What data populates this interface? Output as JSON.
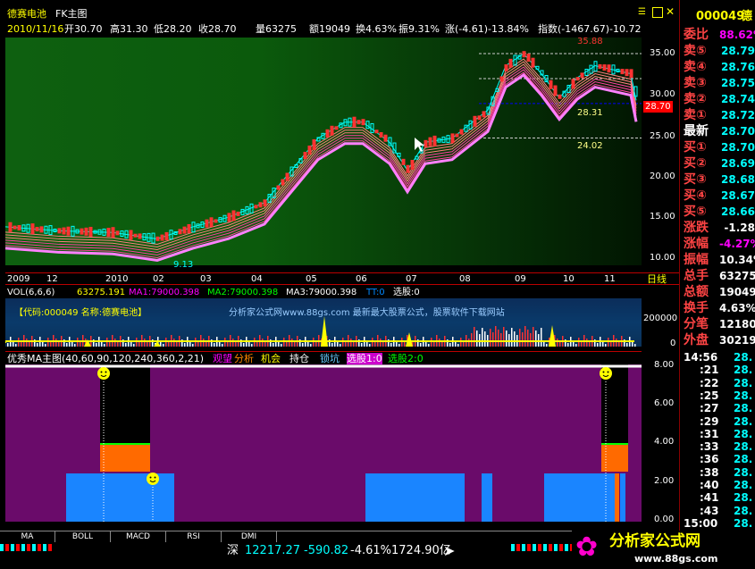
{
  "header": {
    "stock_name": "德赛电池",
    "chart_mode": "FK主图",
    "toolbar_icons": [
      "list-icon",
      "grid-icon",
      "close-icon"
    ],
    "quote_line": {
      "date": "2010/11/16",
      "open": "开30.70",
      "high": "高31.30",
      "low": "低28.20",
      "close": "收28.70",
      "volume": "量63275",
      "amount": "额19049",
      "turnover": "换4.63%",
      "amplitude": "振9.31%",
      "change": "涨(-4.61)-13.84%",
      "index": "指数(-1467.67)-10.72"
    }
  },
  "price_chart": {
    "price_labels": {
      "top": "35.88",
      "mid": "28.31",
      "low": "24.02",
      "bottom": "9.13",
      "current": "28.70"
    },
    "y_ticks": [
      "35.00",
      "30.00",
      "25.00",
      "20.00",
      "15.00",
      "10.00"
    ],
    "x_ticks": [
      "2009",
      "12",
      "2010",
      "02",
      "03",
      "04",
      "05",
      "06",
      "07",
      "08",
      "09",
      "10",
      "11"
    ],
    "period": "日线"
  },
  "volume_panel": {
    "legend": {
      "title": "VOL(6,6,6)",
      "v": "63275.191",
      "ma1": "MA1:79000.398",
      "ma2": "MA2:79000.398",
      "ma3": "MA3:79000.398",
      "tt": "TT:0",
      "xg": "选股:0"
    },
    "watermark": "【代码:000049 名称:德赛电池】",
    "site_note": "分析家公式网www.88gs.com 最新最大股票公式，股票软件下载网站",
    "y_ticks": [
      "200000",
      "0"
    ]
  },
  "indicator_panel": {
    "legend": {
      "title": "优秀MA主图(40,60,90,120,240,360,2,21)",
      "watch": "观望",
      "analysis": "分析",
      "opportunity": "机会",
      "hold": "持仓",
      "lock": "锁坑",
      "pick1": "选股1:0",
      "pick2": "选股2:0"
    },
    "y_ticks": [
      "8.00",
      "6.00",
      "4.00",
      "2.00",
      "0.00"
    ]
  },
  "right_panel": {
    "code": "000049",
    "name_part": "德",
    "weibi_label": "委比",
    "weibi_value": "88.62%",
    "sells": [
      {
        "label": "卖⑤",
        "price": "28.79"
      },
      {
        "label": "卖④",
        "price": "28.76"
      },
      {
        "label": "卖③",
        "price": "28.75"
      },
      {
        "label": "卖②",
        "price": "28.74"
      },
      {
        "label": "卖①",
        "price": "28.72"
      }
    ],
    "latest_label": "最新",
    "latest_value": "28.70",
    "buys": [
      {
        "label": "买①",
        "price": "28.70"
      },
      {
        "label": "买②",
        "price": "28.69"
      },
      {
        "label": "买③",
        "price": "28.68"
      },
      {
        "label": "买④",
        "price": "28.67"
      },
      {
        "label": "买⑤",
        "price": "28.66"
      }
    ],
    "stats": [
      {
        "label": "涨跌",
        "value": "-1.28"
      },
      {
        "label": "涨幅",
        "value": "-4.27%"
      },
      {
        "label": "振幅",
        "value": "10.34%"
      },
      {
        "label": "总手",
        "value": "63275"
      },
      {
        "label": "总额",
        "value": "19049"
      },
      {
        "label": "换手",
        "value": "4.63%"
      },
      {
        "label": "分笔",
        "value": "12180"
      },
      {
        "label": "外盘",
        "value": "30219"
      }
    ],
    "ticks": [
      {
        "time": "14:56",
        "price": "28."
      },
      {
        "time": ":21",
        "price": "28."
      },
      {
        "time": ":22",
        "price": "28."
      },
      {
        "time": ":25",
        "price": "28."
      },
      {
        "time": ":27",
        "price": "28."
      },
      {
        "time": ":29",
        "price": "28."
      },
      {
        "time": ":31",
        "price": "28."
      },
      {
        "time": ":33",
        "price": "28."
      },
      {
        "time": ":36",
        "price": "28."
      },
      {
        "time": ":38",
        "price": "28."
      },
      {
        "time": ":40",
        "price": "28."
      },
      {
        "time": ":41",
        "price": "28."
      },
      {
        "time": ":43",
        "price": "28."
      },
      {
        "time": "15:00",
        "price": "28."
      }
    ]
  },
  "tabs": [
    "MA",
    "BOLL",
    "MACD",
    "RSI",
    "DMI"
  ],
  "status_bar": {
    "market": "深",
    "index_value": "12217.27",
    "change": "-590.82",
    "pct": "-4.61%",
    "amount": "1724.90亿"
  },
  "logo": {
    "text": "分析家公式网",
    "url": "www.88gs.com"
  },
  "colors": {
    "up": "#ff3232",
    "down": "#00ffff",
    "ma_pink": "#ff80ff",
    "purple_zone": "#6a0b6a",
    "blue_zone": "#1a85ff",
    "orange_zone": "#ff6a00"
  }
}
